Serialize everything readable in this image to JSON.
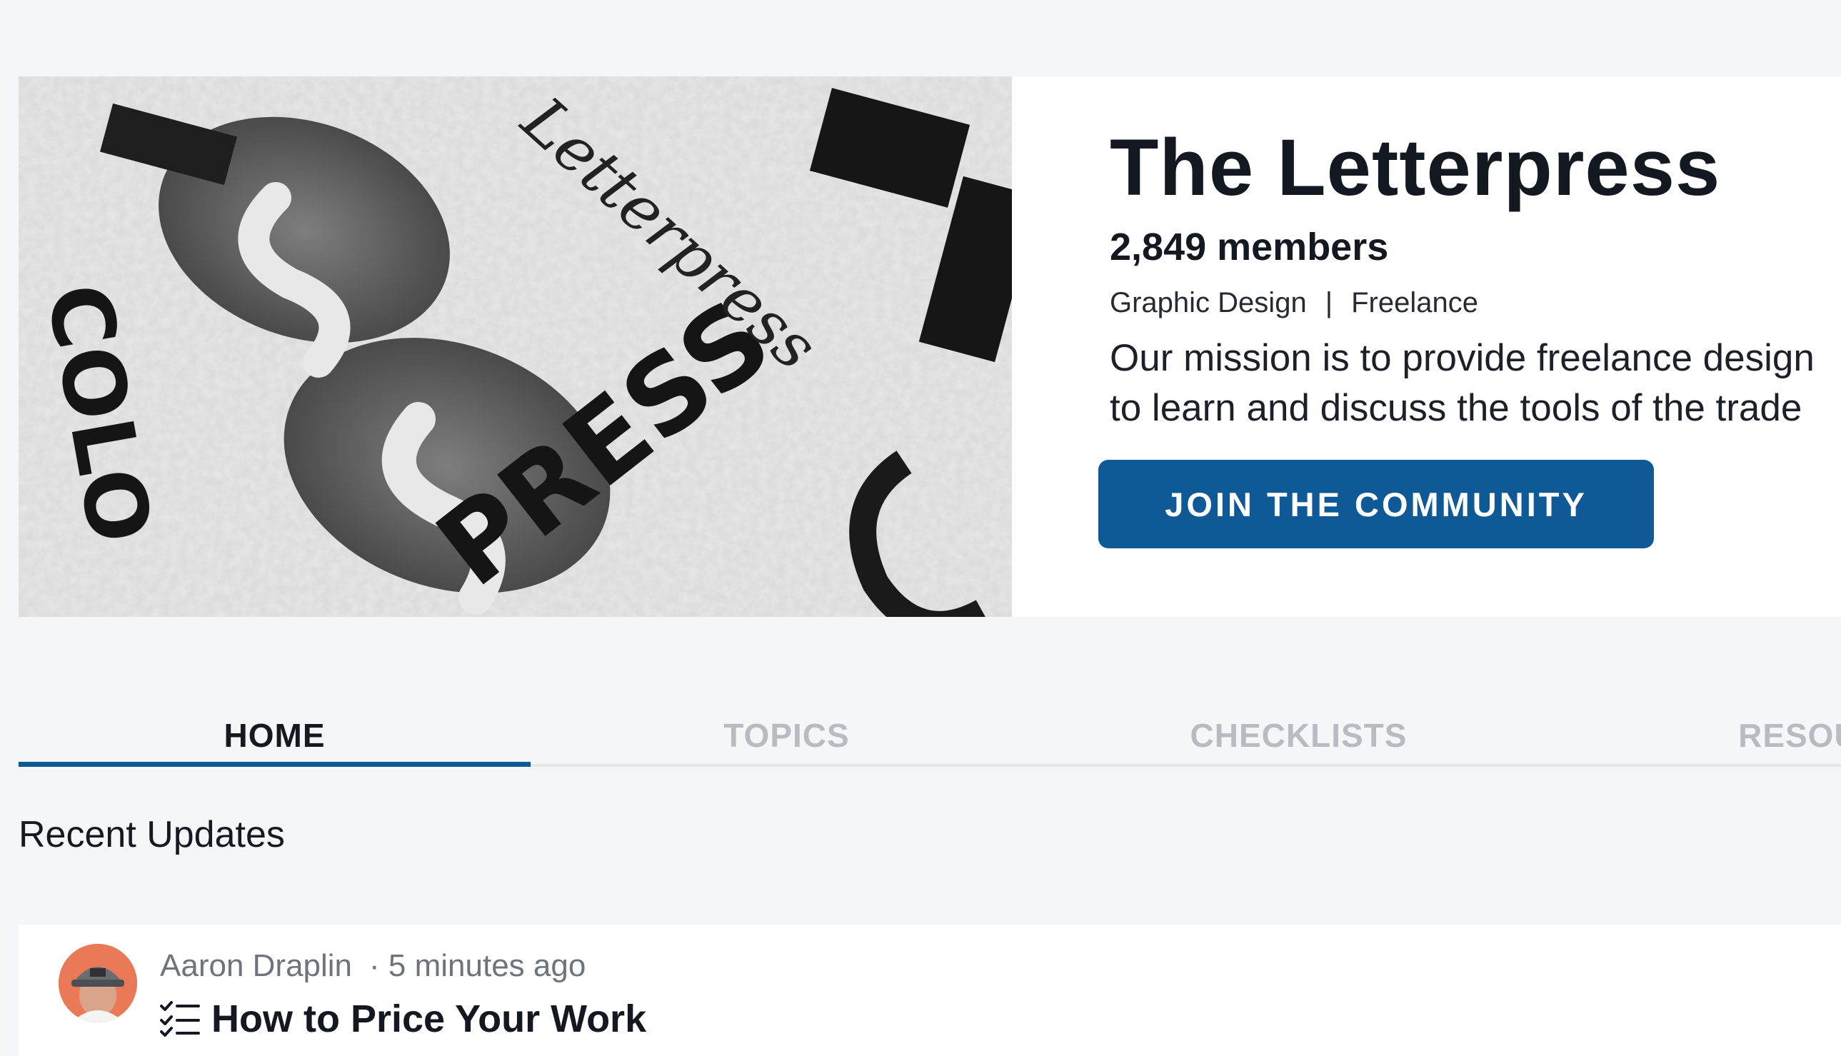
{
  "community": {
    "title": "The Letterpress",
    "members": "2,849 members",
    "tags": [
      "Graphic Design",
      "Freelance"
    ],
    "tag_separator": "|",
    "mission_line1": "Our mission is to provide freelance design",
    "mission_line2": "to learn and discuss the tools of the trade",
    "join_label": "JOIN THE COMMUNITY"
  },
  "tabs": [
    {
      "label": "HOME",
      "active": true
    },
    {
      "label": "TOPICS",
      "active": false
    },
    {
      "label": "CHECKLISTS",
      "active": false
    },
    {
      "label": "RESOUR",
      "active": false
    }
  ],
  "section": {
    "heading": "Recent Updates"
  },
  "updates": [
    {
      "author": "Aaron Draplin",
      "time": "· 5 minutes ago",
      "icon": "checklist-icon",
      "title": "How to Price Your Work"
    }
  ],
  "colors": {
    "accent": "#0f5a96",
    "background": "#f5f6f8",
    "inactive_tab": "#b8bcc2"
  }
}
